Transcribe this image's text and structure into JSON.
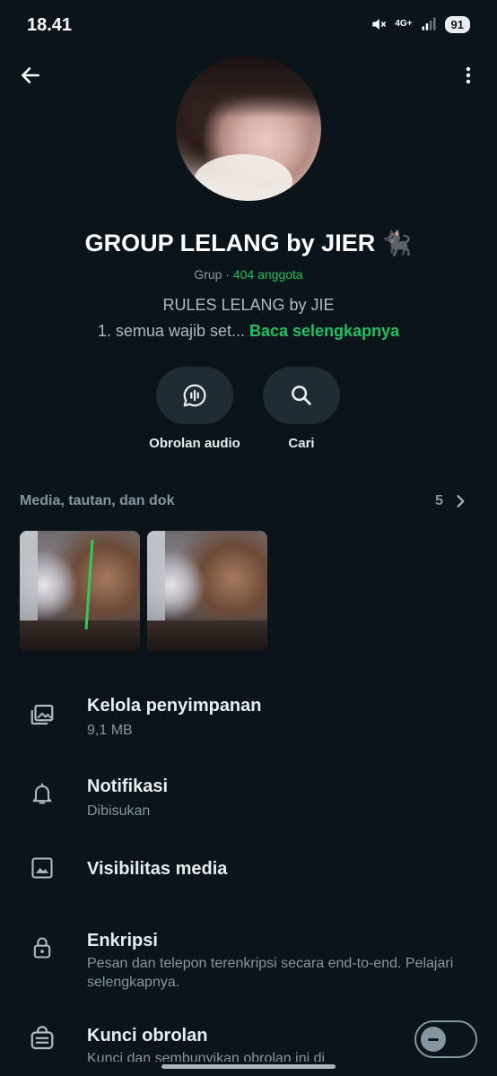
{
  "status_bar": {
    "time": "18.41",
    "network": "4G+",
    "battery": "91",
    "icons": [
      "mute-icon",
      "signal-icon"
    ]
  },
  "top_bar": {
    "back_icon": "arrow-left-icon",
    "more_icon": "more-vertical-icon"
  },
  "group": {
    "name": "GROUP LELANG by JIER 🐈‍⬛",
    "type_label": "Grup",
    "separator": "·",
    "member_count": "404 anggota",
    "description_line1": "RULES LELANG by JIE",
    "description_line2": "1. semua wajib set...",
    "read_more": "Baca selengkapnya"
  },
  "actions": [
    {
      "label": "Obrolan audio",
      "icon": "audio-chat-icon"
    },
    {
      "label": "Cari",
      "icon": "search-icon"
    }
  ],
  "media": {
    "title": "Media, tautan, dan dok",
    "count": "5",
    "chevron_icon": "chevron-right-icon"
  },
  "settings": [
    {
      "title": "Kelola penyimpanan",
      "subtitle": "9,1 MB",
      "icon": "storage-icon"
    },
    {
      "title": "Notifikasi",
      "subtitle": "Dibisukan",
      "icon": "bell-icon"
    },
    {
      "title": "Visibilitas media",
      "subtitle": "",
      "icon": "image-icon"
    },
    {
      "title": "Enkripsi",
      "subtitle": "Pesan dan telepon terenkripsi secara end-to-end. Pelajari selengkapnya.",
      "icon": "lock-icon"
    },
    {
      "title": "Kunci obrolan",
      "subtitle": "Kunci dan sembunyikan obrolan ini di",
      "icon": "chat-lock-icon"
    }
  ],
  "colors": {
    "background": "#0b141a",
    "accent": "#21c063",
    "secondary_text": "#8696a0",
    "button_bg": "#202c33"
  }
}
